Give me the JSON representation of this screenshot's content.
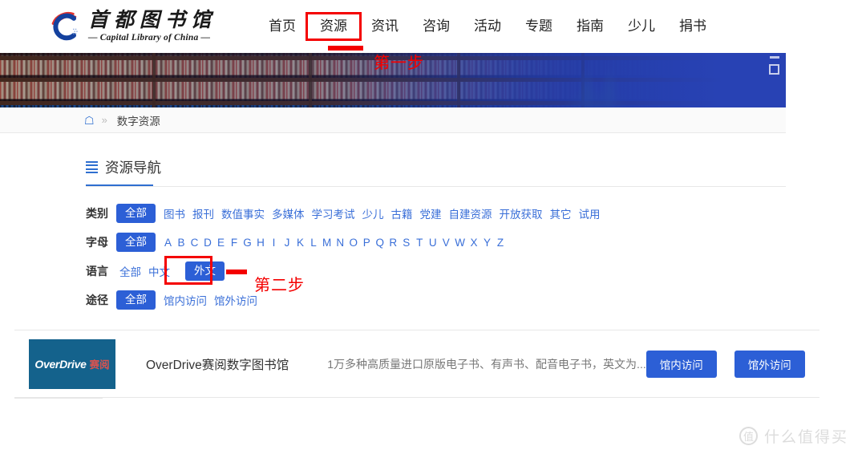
{
  "site": {
    "logo_cn": "首都图书馆",
    "logo_en": "— Capital Library of China —"
  },
  "nav": {
    "items": [
      {
        "label": "首页",
        "highlighted": false
      },
      {
        "label": "资源",
        "highlighted": true
      },
      {
        "label": "资讯",
        "highlighted": false
      },
      {
        "label": "咨询",
        "highlighted": false
      },
      {
        "label": "活动",
        "highlighted": false
      },
      {
        "label": "专题",
        "highlighted": false
      },
      {
        "label": "指南",
        "highlighted": false
      },
      {
        "label": "少儿",
        "highlighted": false
      },
      {
        "label": "捐书",
        "highlighted": false
      }
    ]
  },
  "annotations": {
    "step1": "第一步",
    "step2": "第二步"
  },
  "breadcrumb": {
    "home_icon": "home-icon",
    "separator": "»",
    "current": "数字资源"
  },
  "section": {
    "icon": "list-icon",
    "title": "资源导航"
  },
  "filters": {
    "rows": [
      {
        "label": "类别",
        "all_label": "全部",
        "all_selected": true,
        "options": [
          "图书",
          "报刊",
          "数值事实",
          "多媒体",
          "学习考试",
          "少儿",
          "古籍",
          "党建",
          "自建资源",
          "开放获取",
          "其它",
          "试用"
        ],
        "selected": ""
      },
      {
        "label": "字母",
        "all_label": "全部",
        "all_selected": true,
        "options": [
          "A",
          "B",
          "C",
          "D",
          "E",
          "F",
          "G",
          "H",
          "I",
          "J",
          "K",
          "L",
          "M",
          "N",
          "O",
          "P",
          "Q",
          "R",
          "S",
          "T",
          "U",
          "V",
          "W",
          "X",
          "Y",
          "Z"
        ],
        "selected": ""
      },
      {
        "label": "语言",
        "all_label": "全部",
        "all_selected": false,
        "options": [
          "中文",
          "外文"
        ],
        "selected": "外文"
      },
      {
        "label": "途径",
        "all_label": "全部",
        "all_selected": true,
        "options": [
          "馆内访问",
          "馆外访问"
        ],
        "selected": ""
      }
    ]
  },
  "results": {
    "items": [
      {
        "logo_main": "OverDrive",
        "logo_sub": "赛阅",
        "name": "OverDrive赛阅数字图书馆",
        "description": "1万多种高质量进口原版电子书、有声书、配音电子书，英文为...",
        "actions": [
          "馆内访问",
          "馆外访问"
        ]
      }
    ]
  },
  "watermark": {
    "badge": "值",
    "text": "什么值得买"
  },
  "colors": {
    "accent_blue": "#2c5fd6",
    "link_blue": "#3a6fd8",
    "annotation_red": "#f40000",
    "logo_teal": "#14628c",
    "banner_blue": "#2a42b4"
  }
}
